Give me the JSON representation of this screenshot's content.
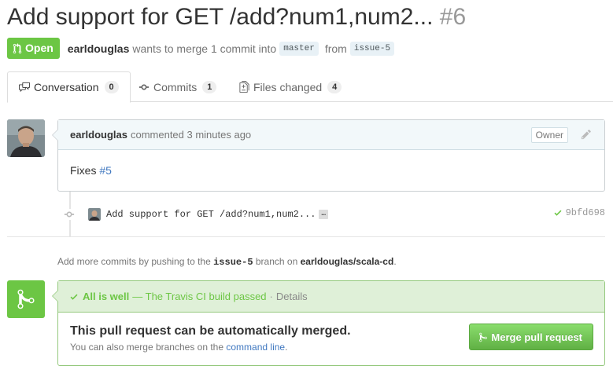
{
  "pr": {
    "title": "Add support for GET /add?num1,num2...",
    "number": "#6",
    "state": "Open",
    "author": "earldouglas",
    "merge_text": "wants to merge 1 commit into",
    "base_branch": "master",
    "from_text": "from",
    "head_branch": "issue-5"
  },
  "tabs": [
    {
      "label": "Conversation",
      "count": "0",
      "icon": "comment-discussion-icon"
    },
    {
      "label": "Commits",
      "count": "1",
      "icon": "git-commit-icon"
    },
    {
      "label": "Files changed",
      "count": "4",
      "icon": "diff-icon"
    }
  ],
  "comment": {
    "author": "earldouglas",
    "time": "commented 3 minutes ago",
    "role": "Owner",
    "body_text": "Fixes",
    "body_link": "#5"
  },
  "commit": {
    "message": "Add support for GET /add?num1,num2...",
    "ellipsis": "…",
    "sha": "9bfd698",
    "status": "success"
  },
  "push_hint": {
    "prefix": "Add more commits by pushing to the",
    "branch": "issue-5",
    "middle": "branch on",
    "repo": "earldouglas/scala-cd",
    "suffix": "."
  },
  "merge": {
    "status_title": "All is well",
    "status_ci": "— The Travis CI build passed",
    "sep": "·",
    "details": "Details",
    "heading": "This pull request can be automatically merged.",
    "sub_prefix": "You can also merge branches on the",
    "sub_link": "command line",
    "sub_suffix": ".",
    "button_label": "Merge pull request"
  },
  "colors": {
    "success": "#6cc644",
    "link": "#4078c0",
    "branch_bg": "#e8f1f6"
  }
}
